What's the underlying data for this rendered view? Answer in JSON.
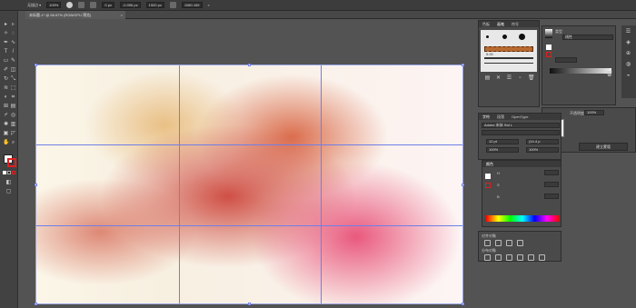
{
  "topbar": {
    "doc_label": "无描边 ▾",
    "stroke_field": "100%",
    "width_field": "0 px",
    "x_field": "-0.006 px",
    "w_field": "1920 px",
    "y_field": "1080.169",
    "flip_icon": "×"
  },
  "tab": {
    "title": "未标题-1* @ 66.67% (RGB/GPU 预览)",
    "close": "×"
  },
  "panels": {
    "brush": {
      "tabs": [
        "色板",
        "画笔",
        "符号"
      ],
      "size_label": "5.00",
      "dot_label": "● ● ●"
    },
    "gradient": {
      "type_label": "类型",
      "mode_field": "线性",
      "row_label": "不透明度",
      "percent": "100%"
    },
    "character": {
      "tabs": [
        "字符",
        "段落",
        "OpenType"
      ],
      "font_field": "Adobe 宋体 Std L",
      "size_field": "12 pt",
      "leading_field": "(14.4 p",
      "h_scale": "100%",
      "v_scale": "100%"
    },
    "color": {
      "title": "颜色",
      "h_label": "H",
      "s_label": "S",
      "b_label": "B",
      "h_value": "",
      "s_value": "",
      "b_value": "",
      "spectrum": true
    },
    "transparency": {
      "opacity_label": "不透明度",
      "opacity_value": "100%",
      "mask_button": "建立蒙版"
    },
    "align": {
      "title": "对齐对象",
      "dist_title": "分布对象"
    }
  },
  "colors": {
    "accent_guides": "#6f7fe6",
    "background": "#535353",
    "panel": "#4a4a4a"
  }
}
